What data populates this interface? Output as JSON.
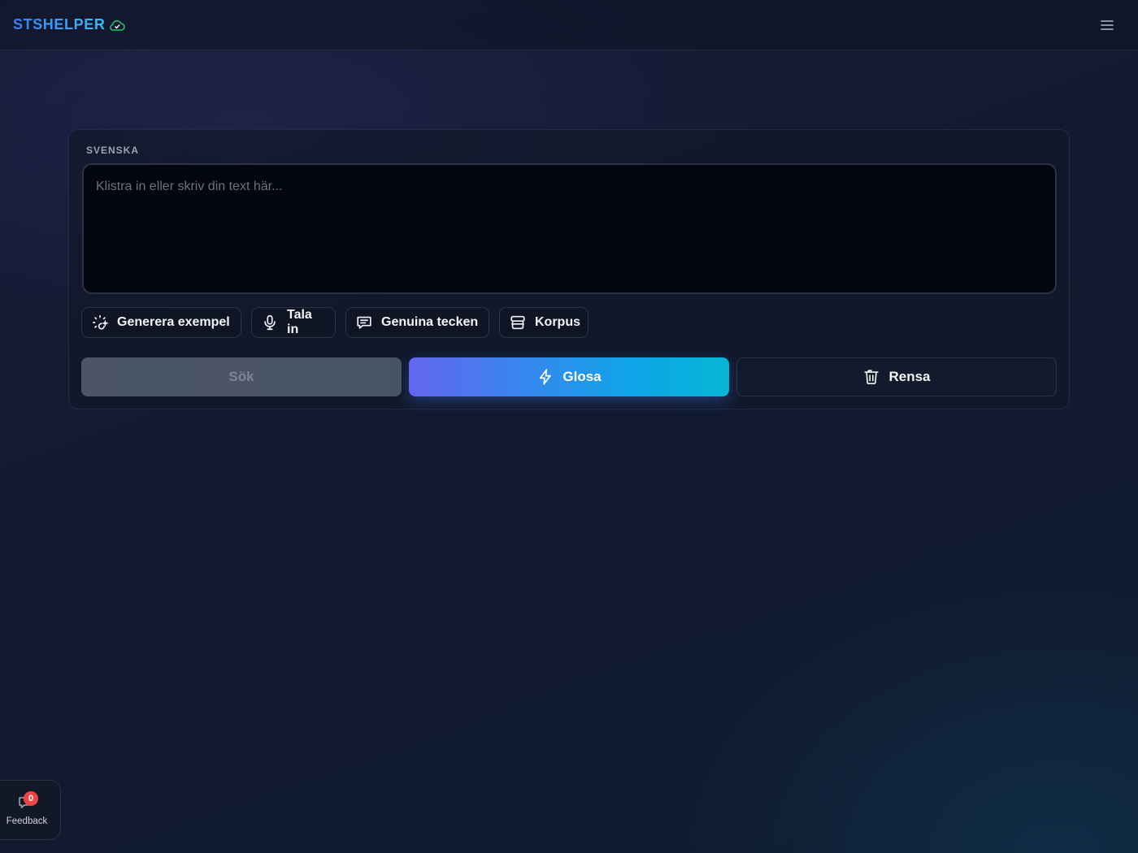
{
  "header": {
    "brand": "STSHELPER",
    "status_icon": "cloud-check-icon",
    "menu_icon": "hamburger-menu-icon"
  },
  "editor": {
    "language_label": "SVENSKA",
    "placeholder": "Klistra in eller skriv din text här...",
    "value": ""
  },
  "tools": [
    {
      "label": "Generera exempel",
      "icon": "sparkle-loader-icon"
    },
    {
      "label": "Tala in",
      "icon": "microphone-icon"
    },
    {
      "label": "Genuina tecken",
      "icon": "message-icon"
    },
    {
      "label": "Korpus",
      "icon": "archive-icon"
    }
  ],
  "actions": {
    "search_label": "Sök",
    "gloss_label": "Glosa",
    "clear_label": "Rensa"
  },
  "feedback": {
    "label": "Feedback",
    "count": "0"
  },
  "colors": {
    "accent_start": "#6366f1",
    "accent_end": "#06b6d4",
    "brand": "#3b82f6",
    "badge": "#ef4444",
    "status_ok": "#22c55e"
  }
}
